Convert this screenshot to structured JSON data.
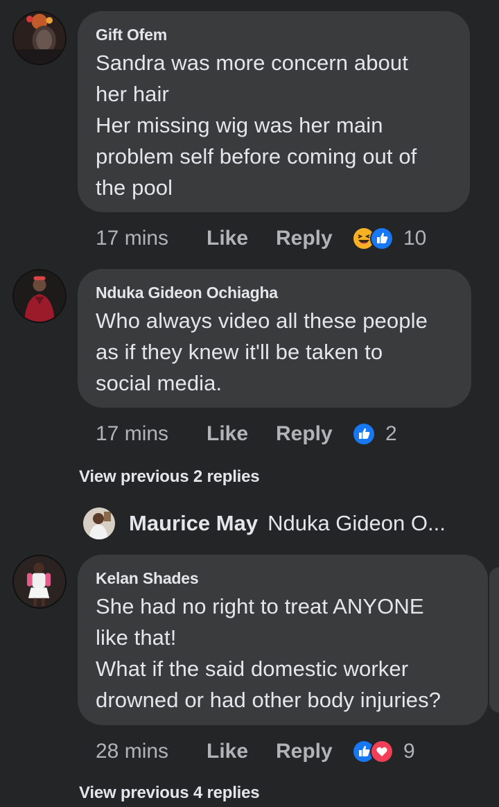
{
  "comments": [
    {
      "author": "Gift Ofem",
      "text": "Sandra was more concern about\nher hair\nHer missing wig was her main\nproblem self before coming out of\nthe pool",
      "time": "17 mins",
      "like_label": "Like",
      "reply_label": "Reply",
      "reactions": [
        "haha-icon",
        "like-icon"
      ],
      "reaction_count": "10"
    },
    {
      "author": "Nduka Gideon Ochiagha",
      "text": "Who always video all these people\nas if they knew it'll be taken to\nsocial media.",
      "time": "17 mins",
      "like_label": "Like",
      "reply_label": "Reply",
      "reactions": [
        "like-icon"
      ],
      "reaction_count": "2",
      "view_replies": "View previous 2 replies",
      "latest_reply": {
        "author": "Maurice May",
        "snippet": "Nduka Gideon O..."
      }
    },
    {
      "author": "Kelan Shades",
      "text": "She had no right to treat ANYONE\nlike that!\nWhat if the said domestic worker\ndrowned or had other body injuries?",
      "time": "28 mins",
      "like_label": "Like",
      "reply_label": "Reply",
      "reactions": [
        "like-icon",
        "love-icon"
      ],
      "reaction_count": "9",
      "view_replies": "View previous 4 replies"
    }
  ],
  "colors": {
    "background": "#242526",
    "bubble": "#3a3b3c",
    "text_primary": "#e4e6eb",
    "text_secondary": "#b0b3b8",
    "like_blue": "#1877f2",
    "love_red": "#f33e58",
    "haha_yellow": "#f7b125"
  }
}
